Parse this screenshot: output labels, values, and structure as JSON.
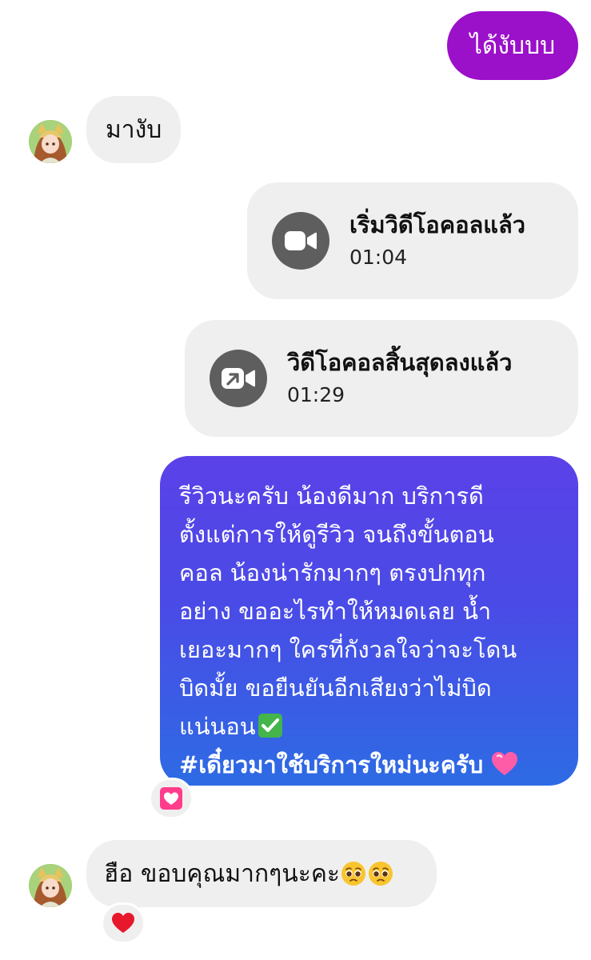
{
  "messages": {
    "outgoing_top": "ได้งับบบ",
    "incoming_1": "มางับ",
    "call_started": {
      "title": "เริ่มวิดีโอคอลแล้ว",
      "time": "01:04"
    },
    "call_ended": {
      "title": "วิดีโอคอลสิ้นสุดลงแล้ว",
      "time": "01:29"
    },
    "review": {
      "lines": [
        "รีวิวนะครับ น้องดีมาก บริการดี",
        "ตั้งแต่การให้ดูรีวิว จนถึงขั้นตอน",
        "คอล น้องน่ารักมากๆ ตรงปกทุก",
        "อย่าง ขออะไรทำให้หมดเลย น้ำ",
        "เยอะมากๆ ใครที่กังวลใจว่าจะโดน",
        "บิดมั้ย ขอยืนยันอีกเสียงว่าไม่บิด",
        "แน่นอน"
      ],
      "hashtag": "#เดี๋ยวมาใช้บริการใหม่นะครับ"
    },
    "incoming_2": "ฮือ ขอบคุณมากๆนะคะ"
  },
  "colors": {
    "outgoing_accent": "#9b10c9",
    "review_gradient_top": "#5a41e8",
    "review_gradient_bottom": "#2d6be4",
    "incoming_bg": "#efefef",
    "call_icon_bg": "#5e5e5e",
    "heart_pink": "#ff3d8b",
    "heart_red": "#e8182c"
  },
  "icons": {
    "call_started": "video-camera-icon",
    "call_ended": "video-call-ended-icon",
    "reaction_1": "heart-box-icon",
    "reaction_2": "red-heart-icon",
    "inline_1": "check-mark-icon",
    "inline_2": "pink-heart-icon",
    "inline_3": "pleading-face-icon"
  }
}
